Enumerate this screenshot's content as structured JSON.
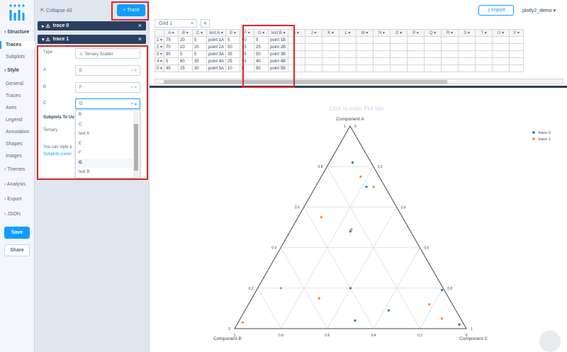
{
  "nav": {
    "structure": "Structure",
    "traces": "Traces",
    "subplots": "Subplots",
    "style": "Style",
    "general": "General",
    "traces2": "Traces",
    "axes": "Axes",
    "legend": "Legend",
    "annotation": "Annotation",
    "shapes": "Shapes",
    "images": "Images",
    "themes": "Themes",
    "analysis": "Analysis",
    "export": "Export",
    "json": "JSON",
    "save": "Save",
    "share": "Share"
  },
  "panel": {
    "collapse_all": "Collapse All",
    "trace_button": "+ Trace",
    "trace0": "trace 0",
    "trace1": "trace 1",
    "type_label": "Type",
    "type_value": "Ternary Scatter",
    "a_label": "A",
    "a_value": "E",
    "b_label": "B",
    "b_value": "F",
    "c_label": "C",
    "c_value": "G",
    "subplots_to_use": "Subplots To Us",
    "ternary": "Ternary",
    "help1": "You can style a",
    "help2": "Subplots panel",
    "dropdown": [
      "B",
      "C",
      "text A",
      "E",
      "F",
      "G",
      "text B"
    ]
  },
  "topbar": {
    "import": "Import",
    "user": "plotly2_demo"
  },
  "grid": {
    "tab": "Grid 1",
    "headers": [
      "A",
      "B",
      "C",
      "text A",
      "E",
      "F",
      "G",
      "text B",
      "I",
      "J",
      "K",
      "L",
      "M",
      "N",
      "O",
      "P",
      "Q",
      "R",
      "S",
      "T",
      "U",
      "V"
    ],
    "rows": [
      [
        "1",
        "75",
        "20",
        "5",
        "point 1A",
        "5",
        "90",
        "5",
        "point 1B"
      ],
      [
        "2",
        "70",
        "10",
        "20",
        "point 2A",
        "50",
        "25",
        "25",
        "point 2B"
      ],
      [
        "3",
        "90",
        "5",
        "5",
        "point 3A",
        "35",
        "15",
        "50",
        "point 3B"
      ],
      [
        "4",
        "5",
        "60",
        "35",
        "point 4A",
        "25",
        "35",
        "40",
        "point 4B"
      ],
      [
        "5",
        "45",
        "25",
        "30",
        "point 5A",
        "10",
        "0",
        "90",
        "point 5B"
      ]
    ]
  },
  "plot": {
    "title_placeholder": "Click to enter Plot title",
    "axis_a": "Component A",
    "axis_b": "Component B",
    "axis_c": "Component C",
    "legend": [
      "trace 0",
      "trace 1"
    ],
    "colors": {
      "trace0": "#1f77b4",
      "trace1": "#ff7f0e"
    }
  },
  "chart_data": {
    "type": "scatter",
    "title": "",
    "ternary": true,
    "axis_labels": [
      "Component A",
      "Component B",
      "Component C"
    ],
    "series": [
      {
        "name": "trace 0",
        "a": [
          0.82,
          0.48,
          0.2,
          0.04,
          0.02,
          0.7,
          0.19,
          0.09
        ],
        "b": [
          0.08,
          0.26,
          0.4,
          0.46,
          0.02,
          0.08,
          0.01,
          0.29
        ],
        "c": [
          0.1,
          0.26,
          0.4,
          0.5,
          0.96,
          0.22,
          0.8,
          0.62
        ]
      },
      {
        "name": "trace 1",
        "a": [
          0.75,
          0.7,
          0.55,
          0.49,
          0.03,
          0.15,
          0.2,
          0.12,
          0.05
        ],
        "b": [
          0.08,
          0.05,
          0.35,
          0.25,
          0.95,
          0.56,
          0.7,
          0.1,
          0.08
        ],
        "c": [
          0.17,
          0.25,
          0.1,
          0.26,
          0.02,
          0.29,
          0.1,
          0.78,
          0.87
        ]
      }
    ]
  }
}
